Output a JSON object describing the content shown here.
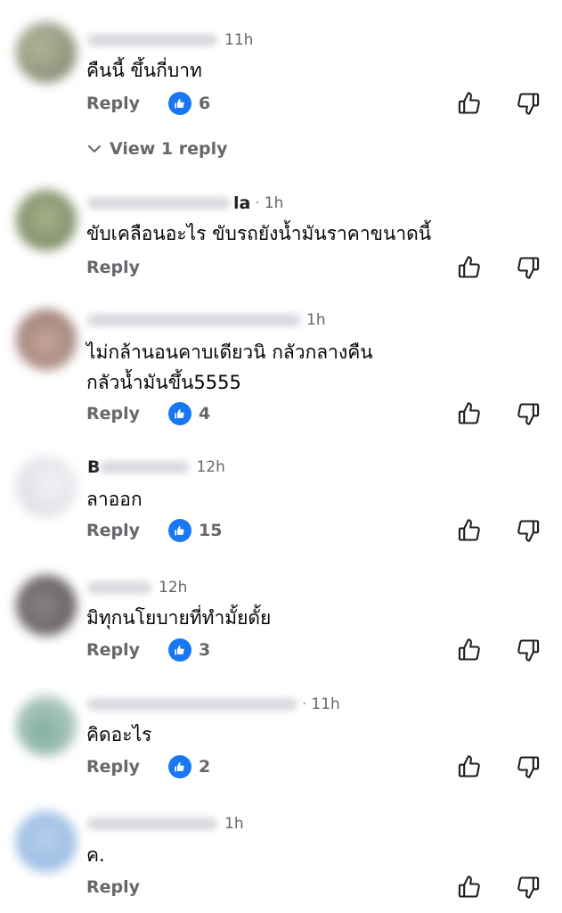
{
  "actions": {
    "reply_label": "Reply"
  },
  "colors": {
    "like_blue": "#1877f2",
    "secondary_text": "#65676b"
  },
  "comments": [
    {
      "visible_name": "",
      "separator": "",
      "time": "11h",
      "text": "คืนนี้ ขึ้นกี่บาท",
      "likes": "6",
      "view_replies": "View 1 reply"
    },
    {
      "visible_name": "la",
      "separator": "·",
      "time": "1h",
      "text": "ขับเคลือนอะไร ขับรถยังน้ำมันราคาขนาดนี้",
      "likes": ""
    },
    {
      "visible_name": "",
      "separator": "",
      "time": "1h",
      "text": "ไม่กล้านอนคาบเดียวนิ กลัวกลางคืน\nกลัวน้ำมันขึ้น5555",
      "likes": "4"
    },
    {
      "visible_name": "B",
      "separator": "",
      "time": "12h",
      "text": "ลาออก",
      "likes": "15"
    },
    {
      "visible_name": "",
      "separator": "",
      "time": "12h",
      "text": "มิทุกนโยบายที่ทำมั้ยดั้ย",
      "likes": "3"
    },
    {
      "visible_name": "",
      "separator": "·",
      "time": "11h",
      "text": "คิดอะไร",
      "likes": "2"
    },
    {
      "visible_name": "",
      "separator": "",
      "time": "1h",
      "text": "ค.",
      "likes": ""
    }
  ]
}
